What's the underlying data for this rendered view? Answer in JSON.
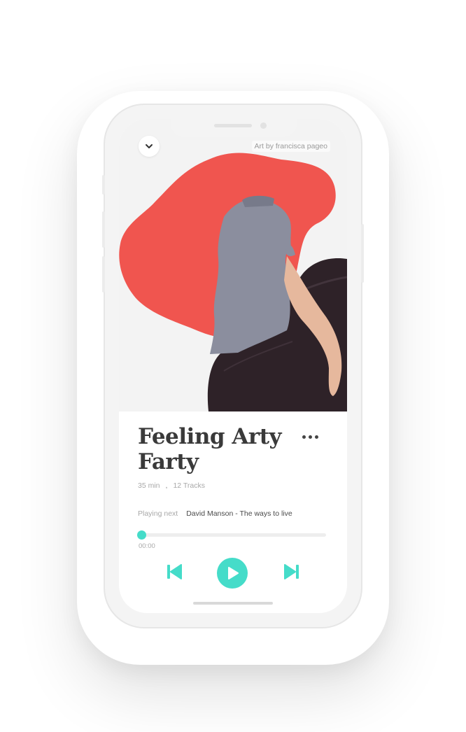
{
  "art_credit": "Art by francisca pageo",
  "playlist": {
    "title": "Feeling Arty Farty",
    "duration": "35 min",
    "separator": ",",
    "tracks": "12 Tracks"
  },
  "up_next": {
    "label": "Playing next",
    "track": "David Manson - The ways to live"
  },
  "player": {
    "elapsed": "00:00",
    "progress_fraction": 0.0
  },
  "icons": {
    "collapse": "chevron-down-icon",
    "more": "more-horizontal-icon",
    "previous": "skip-previous-icon",
    "play": "play-icon",
    "next": "skip-next-icon"
  },
  "colors": {
    "accent": "#45dcc9",
    "title": "#3a3a3a",
    "muted": "#a8a8a8",
    "art_red": "#f0554f",
    "art_dark": "#2e2228",
    "shirt": "#8b8e9e"
  }
}
